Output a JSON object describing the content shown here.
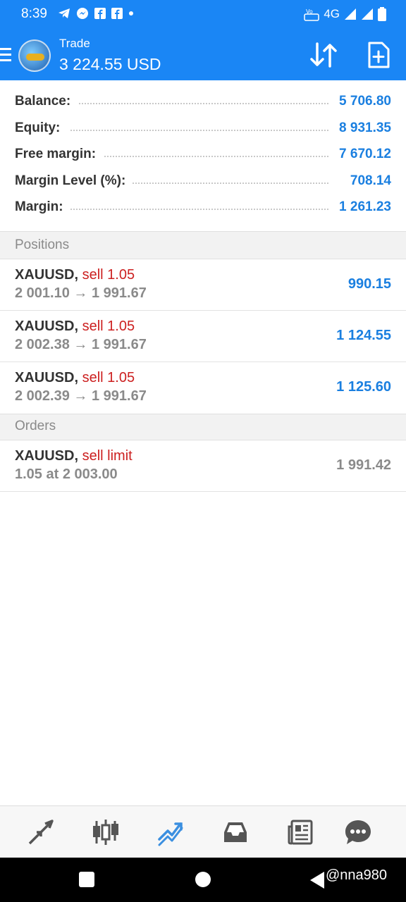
{
  "status_bar": {
    "time": "8:39",
    "network": "4G"
  },
  "app_bar": {
    "title": "Trade",
    "value": "3 224.55 USD"
  },
  "summary": [
    {
      "label": "Balance:",
      "value": "5 706.80"
    },
    {
      "label": "Equity:",
      "value": "8 931.35"
    },
    {
      "label": "Free margin:",
      "value": "7 670.12"
    },
    {
      "label": "Margin Level (%):",
      "value": "708.14"
    },
    {
      "label": "Margin:",
      "value": "1 261.23"
    }
  ],
  "positions_header": "Positions",
  "positions": [
    {
      "symbol": "XAUUSD,",
      "side": "sell 1.05",
      "prices": "2 001.10 → 1 991.67",
      "profit": "990.15"
    },
    {
      "symbol": "XAUUSD,",
      "side": "sell 1.05",
      "prices": "2 002.38 → 1 991.67",
      "profit": "1 124.55"
    },
    {
      "symbol": "XAUUSD,",
      "side": "sell 1.05",
      "prices": "2 002.39 → 1 991.67",
      "profit": "1 125.60"
    }
  ],
  "orders_header": "Orders",
  "orders": [
    {
      "symbol": "XAUUSD,",
      "side": "sell limit",
      "detail": "1.05 at 2 003.00",
      "price": "1 991.42"
    }
  ],
  "bottom_nav": [
    "quotes-icon",
    "chart-icon",
    "trade-icon",
    "history-icon",
    "news-icon",
    "chat-icon"
  ],
  "watermark": "@nna980",
  "colors": {
    "app_bar": "#1a86f5",
    "value_blue": "#1a7fe0",
    "sell_red": "#cc2020",
    "active_nav": "#3b8fe0"
  }
}
